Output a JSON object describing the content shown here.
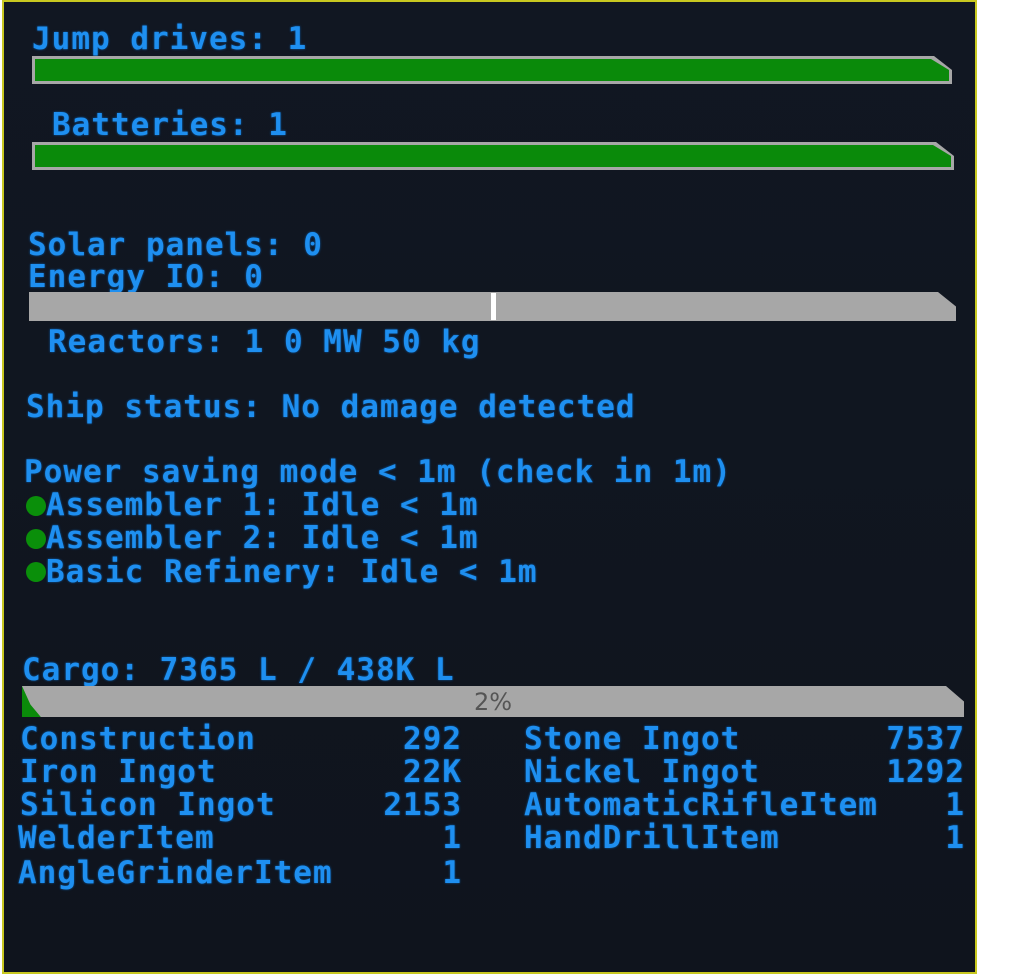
{
  "colors": {
    "text": "#1e8ff0",
    "bar_fill": "#0a8a0a",
    "bar_frame": "#a7a7a7",
    "status_dot": "#0a8f0a",
    "background": "#111722"
  },
  "jump_drives": {
    "label": "Jump drives: 1",
    "fill_percent": 100
  },
  "batteries": {
    "label": "Batteries: 1",
    "fill_percent": 100
  },
  "solar": {
    "label": "Solar panels: 0"
  },
  "energy_io": {
    "label": "Energy IO: 0",
    "marker_fraction": 0.5
  },
  "reactors": {
    "label": "Reactors: 1 0 MW 50 kg"
  },
  "ship_status": {
    "label": "Ship status: No damage detected"
  },
  "power_saving": {
    "label": "Power saving mode < 1m (check in 1m)"
  },
  "production": [
    {
      "label": "Assembler 1: Idle < 1m",
      "status": "ok"
    },
    {
      "label": "Assembler 2: Idle < 1m",
      "status": "ok"
    },
    {
      "label": "Basic Refinery: Idle < 1m",
      "status": "ok"
    }
  ],
  "cargo": {
    "label": "Cargo: 7365 L / 438K L",
    "percent_text": "2%",
    "fill_percent": 2
  },
  "inventory_left": [
    {
      "name": "Construction",
      "amount": "292"
    },
    {
      "name": "Iron Ingot",
      "amount": "22K"
    },
    {
      "name": "Silicon Ingot",
      "amount": "2153"
    },
    {
      "name": "WelderItem",
      "amount": "1"
    },
    {
      "name": "AngleGrinderItem",
      "amount": "1"
    }
  ],
  "inventory_right": [
    {
      "name": "Stone Ingot",
      "amount": "7537"
    },
    {
      "name": "Nickel Ingot",
      "amount": "1292"
    },
    {
      "name": "AutomaticRifleItem",
      "amount": "1"
    },
    {
      "name": "HandDrillItem",
      "amount": "1"
    }
  ]
}
